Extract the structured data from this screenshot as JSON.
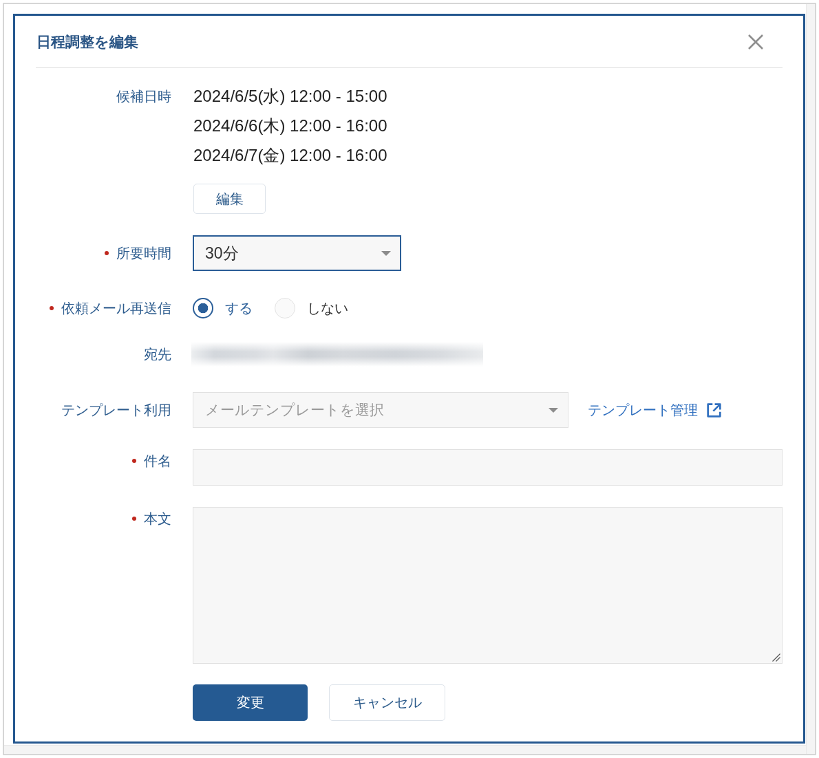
{
  "dialog": {
    "title": "日程調整を編集"
  },
  "fields": [
    {
      "kind": "dates",
      "label": "候補日時",
      "required": false,
      "values": [
        "2024/6/5(水) 12:00 - 15:00",
        "2024/6/6(木) 12:00 - 16:00",
        "2024/6/7(金) 12:00 - 16:00"
      ],
      "button": "編集"
    },
    {
      "kind": "select",
      "label": "所要時間",
      "required": true,
      "value": "30分",
      "focused": true
    },
    {
      "kind": "radio",
      "label": "依頼メール再送信",
      "required": true,
      "options": [
        {
          "label": "する",
          "selected": true
        },
        {
          "label": "しない",
          "selected": false
        }
      ]
    },
    {
      "kind": "recipient",
      "label": "宛先",
      "required": false,
      "blurred": true
    },
    {
      "kind": "template",
      "label": "テンプレート利用",
      "required": false,
      "placeholder": "メールテンプレートを選択",
      "focused": false,
      "link": {
        "label": "テンプレート管理",
        "external": true
      }
    },
    {
      "kind": "text",
      "label": "件名",
      "required": true,
      "focused": false
    },
    {
      "kind": "textarea",
      "label": "本文",
      "required": true,
      "focused": false
    }
  ],
  "buttons": [
    {
      "label": "変更",
      "primary": true
    },
    {
      "label": "キャンセル",
      "primary": false
    }
  ]
}
